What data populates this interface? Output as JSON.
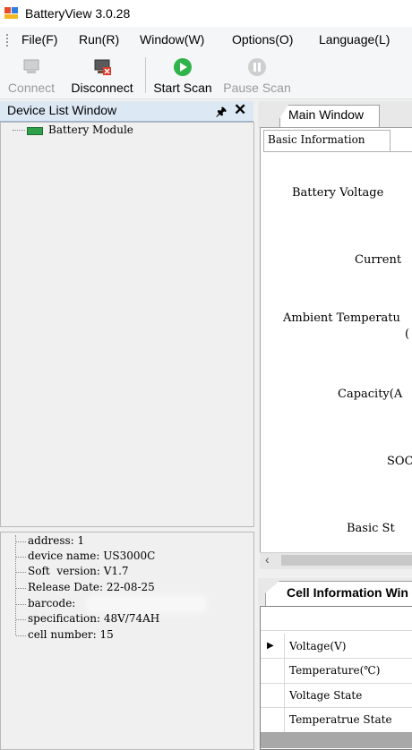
{
  "window": {
    "title": "BatteryView 3.0.28"
  },
  "menu": [
    "File(F)",
    "Run(R)",
    "Window(W)",
    "Options(O)",
    "Language(L)"
  ],
  "toolbar": {
    "connect": "Connect",
    "disconnect": "Disconnect",
    "start_scan": "Start Scan",
    "pause_scan": "Pause Scan"
  },
  "device_list": {
    "title": "Device List Window",
    "tree": [
      "Battery Module"
    ]
  },
  "device_info": [
    "address: 1",
    "device name: US3000C",
    "Soft  version: V1.7",
    "Release Date: 22-08-25",
    "barcode:",
    "specification: 48V/74AH",
    "cell number: 15"
  ],
  "main_window": {
    "tab": "Main Window",
    "subtab": "Basic Information",
    "fields": {
      "battery_voltage": "Battery Voltage",
      "current": "Current",
      "ambient_temp_1": "Ambient Temperatu",
      "ambient_temp_2": "(",
      "capacity": "Capacity(A",
      "soc": "SOC",
      "basic_status": "Basic St"
    }
  },
  "cell_window": {
    "tab": "Cell Information Win",
    "rows": [
      "Voltage(V)",
      "Temperature(℃)",
      "Voltage State",
      "Temperatrue State"
    ]
  },
  "colors": {
    "start_scan_green": "#2fb34a",
    "disabled_text": "#9a9a9a",
    "pane_header": "#dde8f5"
  },
  "icons": {
    "app": "battery-app-icon",
    "connect": "computer-connect-icon",
    "disconnect": "computer-disconnect-icon",
    "start_scan": "play-icon",
    "pause_scan": "pause-icon"
  }
}
